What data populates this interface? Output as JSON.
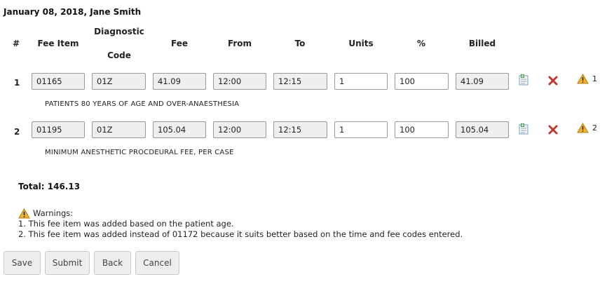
{
  "header": {
    "title": "January 08, 2018, Jane Smith"
  },
  "table": {
    "headers": {
      "num": "#",
      "fee_item": "Fee Item",
      "diag_line1": "Diagnostic",
      "diag_line2": "Code",
      "fee": "Fee",
      "from": "From",
      "to": "To",
      "units": "Units",
      "pct": "%",
      "billed": "Billed"
    },
    "rows": [
      {
        "num": "1",
        "fee_item": "01165",
        "diag_code": "01Z",
        "fee": "41.09",
        "from": "12:00",
        "to": "12:15",
        "units": "1",
        "pct": "100",
        "billed": "41.09",
        "warning_ref": "1",
        "description": "PATIENTS 80 YEARS OF AGE AND OVER-ANAESTHESIA"
      },
      {
        "num": "2",
        "fee_item": "01195",
        "diag_code": "01Z",
        "fee": "105.04",
        "from": "12:00",
        "to": "12:15",
        "units": "1",
        "pct": "100",
        "billed": "105.04",
        "warning_ref": "2",
        "description": "MINIMUM ANESTHETIC PROCDEURAL FEE, PER CASE"
      }
    ]
  },
  "total": {
    "label": "Total: 146.13"
  },
  "warnings": {
    "title": "Warnings:",
    "items": [
      "1. This fee item was added based on the patient age.",
      "2. This fee item was added instead of 01172 because it suits better based on the time and fee codes entered."
    ]
  },
  "buttons": {
    "save": "Save",
    "submit": "Submit",
    "back": "Back",
    "cancel": "Cancel"
  },
  "icons": {
    "add": "add-note-icon",
    "delete": "delete-x-icon",
    "warning": "warning-triangle-icon"
  },
  "colors": {
    "delete": "#c0392b",
    "warning": "#e8a317",
    "add": "#3b7fb8"
  }
}
